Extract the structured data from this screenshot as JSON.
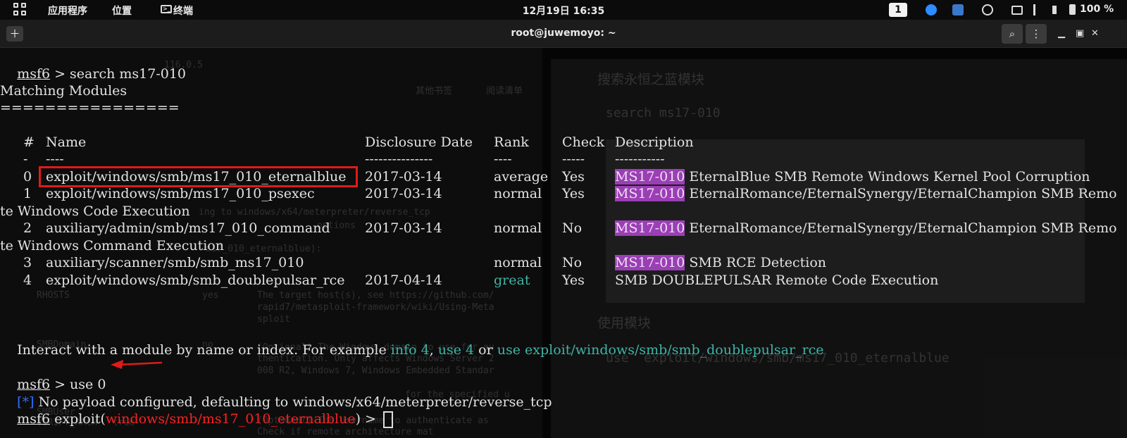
{
  "topbar": {
    "apps": "应用程序",
    "places": "位置",
    "terminal": "终端",
    "clock": "12月19日 16:35",
    "workspace": "1",
    "battery": "100 %"
  },
  "window": {
    "title": "root@juwemoyo: ~"
  },
  "terminal": {
    "prompt": "msf6",
    "cmd1": " > search ms17-010",
    "matching": "Matching Modules",
    "rule": "================",
    "headers": {
      "num": "#",
      "name": "Name",
      "date": "Disclosure Date",
      "rank": "Rank",
      "check": "Check",
      "desc": "Description"
    },
    "dashes": {
      "num": "-",
      "name": "----",
      "date": "---------------",
      "rank": "----",
      "check": "-----",
      "desc": "-----------"
    },
    "rows": [
      {
        "num": "0",
        "name": "exploit/windows/smb/ms17_010_eternalblue",
        "date": "2017-03-14",
        "rank": "average",
        "check": "Yes",
        "tag": "MS17-010",
        "desc": " EternalBlue SMB Remote Windows Kernel Pool Corruption"
      },
      {
        "num": "1",
        "name": "exploit/windows/smb/ms17_010_psexec",
        "date": "2017-03-14",
        "rank": "normal",
        "check": "Yes",
        "tag": "MS17-010",
        "desc": " EternalRomance/EternalSynergy/EternalChampion SMB Remo",
        "wrap": "te Windows Code Execution"
      },
      {
        "num": "2",
        "name": "auxiliary/admin/smb/ms17_010_command",
        "date": "2017-03-14",
        "rank": "normal",
        "check": "No",
        "tag": "MS17-010",
        "desc": " EternalRomance/EternalSynergy/EternalChampion SMB Remo",
        "wrap": "te Windows Command Execution"
      },
      {
        "num": "3",
        "name": "auxiliary/scanner/smb/smb_ms17_010",
        "date": "",
        "rank": "normal",
        "check": "No",
        "tag": "MS17-010",
        "desc": " SMB RCE Detection"
      },
      {
        "num": "4",
        "name": "exploit/windows/smb/smb_doublepulsar_rce",
        "date": "2017-04-14",
        "rank": "great",
        "check": "Yes",
        "tag": "",
        "desc": "SMB DOUBLEPULSAR Remote Code Execution"
      }
    ],
    "interact": {
      "a": "Interact with a module by name or index. For example ",
      "b": "info 4",
      "c": ", ",
      "d": "use 4",
      "e": " or ",
      "f": "use exploit/windows/smb/smb_doublepulsar_rce"
    },
    "cmd2": " > use 0",
    "notice_mark": "[*]",
    "notice": " No payload configured, defaulting to windows/x64/meterpreter/reverse_tcp",
    "exploit_prefix": " exploit(",
    "exploit_module": "windows/smb/ms17_010_eternalblue",
    "exploit_suffix": ") > "
  },
  "background": {
    "doc_heading1": "搜索永恒之蓝模块",
    "doc_code1": "search ms17-010",
    "doc_heading2": "使用模块",
    "doc_code2": "use  exploit/windows/smb/ms17_010_eternalblue",
    "browser_url": "116.0.5",
    "bookmarks": "其他书签",
    "reading": "阅读清单",
    "ghost_rhosts": "RHOSTS",
    "ghost_yes": "yes",
    "ghost_true": "true",
    "ghost_no": "no",
    "ghost_target": "The target host(s), see https://github.com/",
    "ghost_rapid": "rapid7/metasploit-framework/wiki/Using-Meta",
    "ghost_sploit": "sploit",
    "ghost_smbdomain": "SMBDomain",
    "ghost_optional": "(Optional) The Windows domain to use for au",
    "ghost_authen": "thentication. Only affects Windows Server 2",
    "ghost_server": "008 R2, Windows 7, Windows Embedded Standar",
    "ghost_payload": "ing to windows/x64/meterpreter/reverse_tcp",
    "ghost_options": "options",
    "ghost_eternal": "s17_010_eternalblue):",
    "ghost_for": "for the specified u",
    "ghost_smbuser": "SMBUser",
    "ghost_verify": "VERIFY_ARCH",
    "ghost_username": "(Optional) The username to authenticate as",
    "ghost_check": "Check if remote architecture mat"
  }
}
